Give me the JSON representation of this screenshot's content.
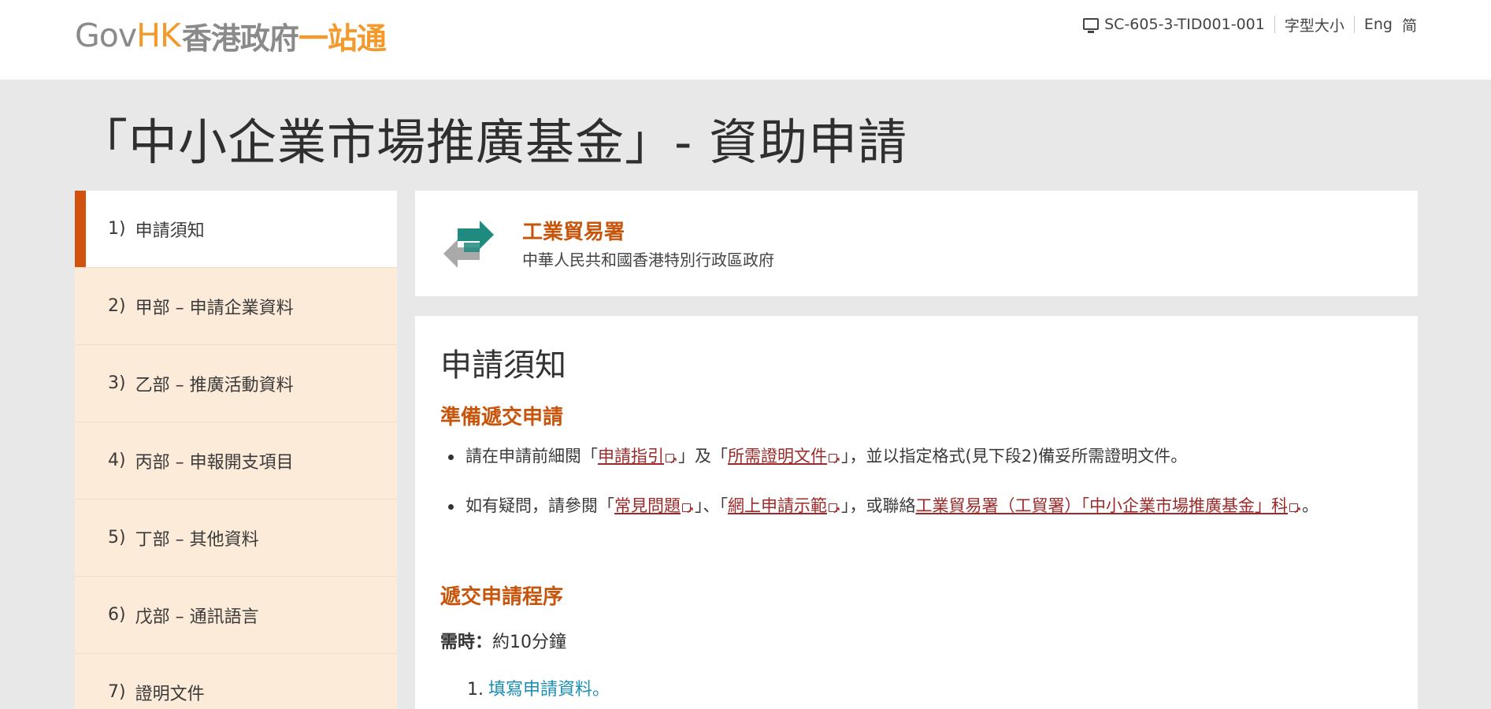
{
  "header": {
    "logo_gov": "Gov",
    "logo_hk": "HK",
    "logo_zh_gray": "香港政府",
    "logo_zh_orange": "一站通",
    "session_id": "SC-605-3-TID001-001",
    "font_size_label": "字型大小",
    "lang_en": "Eng",
    "lang_sc": "简"
  },
  "page": {
    "title": "「中小企業市場推廣基金」- 資助申請"
  },
  "sidebar": {
    "items": [
      {
        "num": "1)",
        "label": "申請須知",
        "active": true
      },
      {
        "num": "2)",
        "label": "甲部 – 申請企業資料",
        "active": false
      },
      {
        "num": "3)",
        "label": "乙部 – 推廣活動資料",
        "active": false
      },
      {
        "num": "4)",
        "label": "丙部 – 申報開支項目",
        "active": false
      },
      {
        "num": "5)",
        "label": "丁部 – 其他資料",
        "active": false
      },
      {
        "num": "6)",
        "label": "戊部 – 通訊語言",
        "active": false
      },
      {
        "num": "7)",
        "label": "證明文件",
        "active": false
      }
    ]
  },
  "department": {
    "name": "工業貿易署",
    "subtitle": "中華人民共和國香港特別行政區政府",
    "logo_icon": "tid-arrows-logo"
  },
  "main": {
    "title": "申請須知",
    "section1_heading": "準備遞交申請",
    "bullet1": {
      "pre": "請在申請前細閱「",
      "link1": "申請指引",
      "mid": "」及「",
      "link2": "所需證明文件",
      "post": "」，並以指定格式(見下段2)備妥所需證明文件。"
    },
    "bullet2": {
      "pre": "如有疑問，請參閱「",
      "link1": "常見問題",
      "mid1": "」、「",
      "link2": "網上申請示範",
      "mid2": "」，或聯絡",
      "link3": "工業貿易署（工貿署）「中小企業市場推廣基金」科",
      "post": "。"
    },
    "section2_heading": "遞交申請程序",
    "time_label": "需時：",
    "time_value": "約10分鐘",
    "steps": [
      {
        "num": "1.",
        "label": "填寫申請資料。"
      }
    ]
  },
  "colors": {
    "brand_orange": "#f39a2b",
    "accent": "#d0520e",
    "link": "#9c2a2a",
    "step_link": "#1b8fb1",
    "sidebar_bg": "#fdebd9"
  }
}
